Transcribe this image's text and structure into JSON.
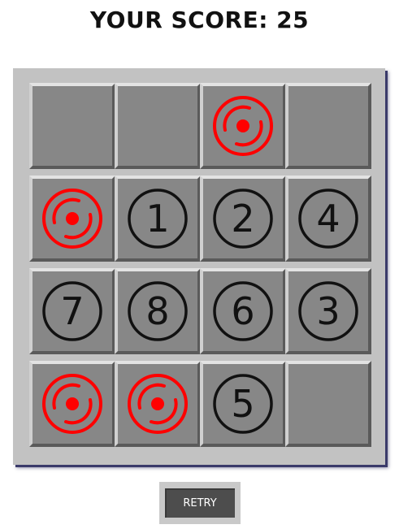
{
  "header": {
    "score_label": "YOUR SCORE:",
    "score_value": "25"
  },
  "board": {
    "rows": 4,
    "cols": 4,
    "cells": [
      {
        "type": "empty"
      },
      {
        "type": "empty"
      },
      {
        "type": "target",
        "icon": "target-icon"
      },
      {
        "type": "empty"
      },
      {
        "type": "target",
        "icon": "target-icon"
      },
      {
        "type": "number",
        "value": "1"
      },
      {
        "type": "number",
        "value": "2"
      },
      {
        "type": "number",
        "value": "4"
      },
      {
        "type": "number",
        "value": "7"
      },
      {
        "type": "number",
        "value": "8"
      },
      {
        "type": "number",
        "value": "6"
      },
      {
        "type": "number",
        "value": "3"
      },
      {
        "type": "target",
        "icon": "target-icon"
      },
      {
        "type": "target",
        "icon": "target-icon"
      },
      {
        "type": "number",
        "value": "5"
      },
      {
        "type": "empty"
      }
    ]
  },
  "retry_label": "RETRY",
  "colors": {
    "board": "#c2c2c2",
    "cell": "#878787",
    "target": "#ff0000",
    "number": "#111111",
    "button": "#4d4d4d"
  }
}
